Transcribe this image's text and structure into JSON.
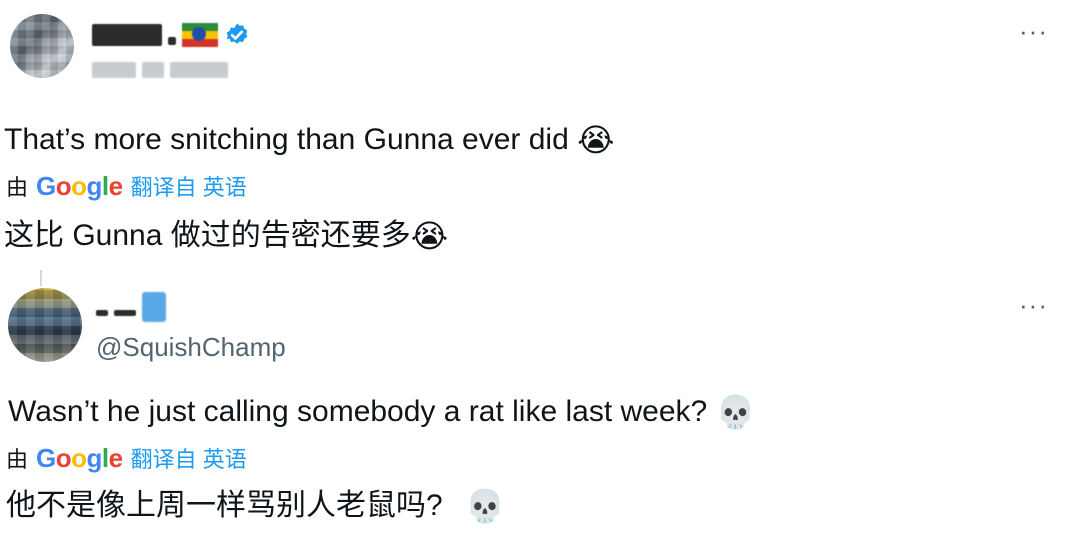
{
  "tweet1": {
    "more_label": "···",
    "text": "That’s more snitching than Gunna ever did",
    "emoji": "😭",
    "translation": {
      "by_label": "由",
      "provider": "Google",
      "translated_from": "翻译自 英语",
      "text": "这比 Gunna 做过的告密还要多",
      "emoji": "😭"
    }
  },
  "tweet2": {
    "handle": "@SquishChamp",
    "more_label": "···",
    "text": "Wasn’t he just calling somebody a rat like last week?",
    "emoji": "💀",
    "translation": {
      "by_label": "由",
      "provider": "Google",
      "translated_from": "翻译自 英语",
      "text": "他不是像上周一样骂别人老鼠吗?",
      "emoji": "💀"
    }
  },
  "colors": {
    "text": "#0f1419",
    "secondary": "#536471",
    "link": "#1d9bf0",
    "verified": "#1d9bf0"
  }
}
